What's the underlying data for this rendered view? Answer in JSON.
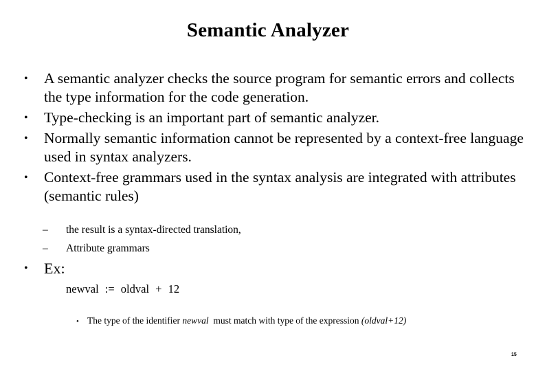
{
  "slide": {
    "title": "Semantic Analyzer",
    "bullet_symbol": "•",
    "dash_symbol": "–",
    "bullets": [
      {
        "text": "A semantic analyzer checks the source program for semantic errors and collects the type information for the code generation."
      },
      {
        "text": "Type-checking is an important part of semantic analyzer."
      },
      {
        "text": "Normally semantic information cannot be represented by a context-free language used in syntax analyzers."
      },
      {
        "text": "Context-free grammars used in the syntax analysis are integrated with attributes (semantic rules)"
      }
    ],
    "sub_bullets": [
      {
        "text": "the result is a syntax-directed translation,"
      },
      {
        "text": "Attribute grammars"
      }
    ],
    "example": {
      "label": "Ex:",
      "code": "newval := oldval + 12",
      "note": {
        "prefix": "The type of the identifier ",
        "identifier": "newval",
        "middle": "  must match with type of the expression ",
        "expression": "(oldval+12)"
      }
    },
    "page_number": "15"
  }
}
